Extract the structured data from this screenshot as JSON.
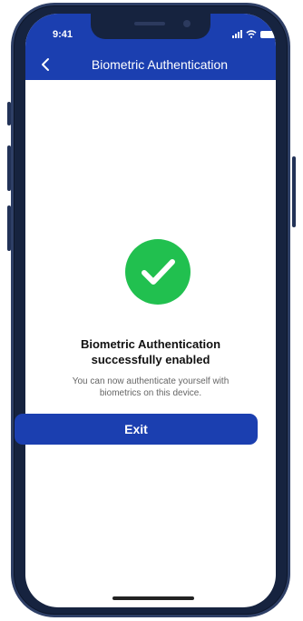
{
  "status_bar": {
    "time": "9:41"
  },
  "header": {
    "title": "Biometric Authentication",
    "back_icon": "chevron-left-icon"
  },
  "success": {
    "icon": "checkmark-circle-icon",
    "icon_color": "#21c04f",
    "heading_line1": "Biometric Authentication",
    "heading_line2": "successfully enabled",
    "message_line1": "You can now authenticate yourself with",
    "message_line2": "biometrics on this device."
  },
  "actions": {
    "exit_label": "Exit"
  },
  "colors": {
    "brand_blue": "#1b3fb0",
    "frame": "#16233f"
  }
}
